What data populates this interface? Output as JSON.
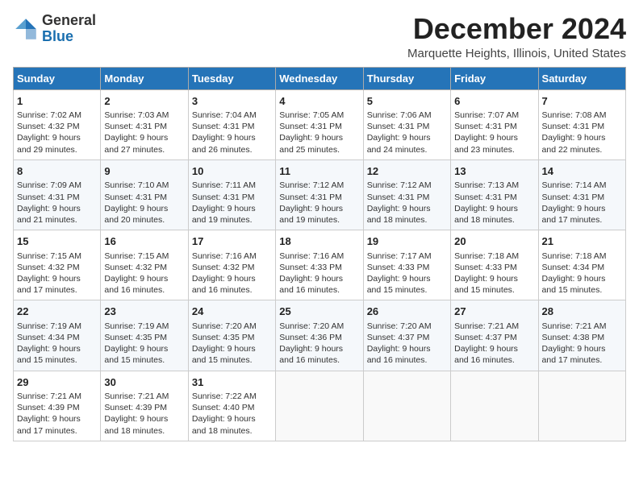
{
  "logo": {
    "general": "General",
    "blue": "Blue"
  },
  "title": "December 2024",
  "location": "Marquette Heights, Illinois, United States",
  "days_of_week": [
    "Sunday",
    "Monday",
    "Tuesday",
    "Wednesday",
    "Thursday",
    "Friday",
    "Saturday"
  ],
  "weeks": [
    [
      {
        "day": "1",
        "sunrise": "7:02 AM",
        "sunset": "4:32 PM",
        "daylight": "9 hours and 29 minutes."
      },
      {
        "day": "2",
        "sunrise": "7:03 AM",
        "sunset": "4:31 PM",
        "daylight": "9 hours and 27 minutes."
      },
      {
        "day": "3",
        "sunrise": "7:04 AM",
        "sunset": "4:31 PM",
        "daylight": "9 hours and 26 minutes."
      },
      {
        "day": "4",
        "sunrise": "7:05 AM",
        "sunset": "4:31 PM",
        "daylight": "9 hours and 25 minutes."
      },
      {
        "day": "5",
        "sunrise": "7:06 AM",
        "sunset": "4:31 PM",
        "daylight": "9 hours and 24 minutes."
      },
      {
        "day": "6",
        "sunrise": "7:07 AM",
        "sunset": "4:31 PM",
        "daylight": "9 hours and 23 minutes."
      },
      {
        "day": "7",
        "sunrise": "7:08 AM",
        "sunset": "4:31 PM",
        "daylight": "9 hours and 22 minutes."
      }
    ],
    [
      {
        "day": "8",
        "sunrise": "7:09 AM",
        "sunset": "4:31 PM",
        "daylight": "9 hours and 21 minutes."
      },
      {
        "day": "9",
        "sunrise": "7:10 AM",
        "sunset": "4:31 PM",
        "daylight": "9 hours and 20 minutes."
      },
      {
        "day": "10",
        "sunrise": "7:11 AM",
        "sunset": "4:31 PM",
        "daylight": "9 hours and 19 minutes."
      },
      {
        "day": "11",
        "sunrise": "7:12 AM",
        "sunset": "4:31 PM",
        "daylight": "9 hours and 19 minutes."
      },
      {
        "day": "12",
        "sunrise": "7:12 AM",
        "sunset": "4:31 PM",
        "daylight": "9 hours and 18 minutes."
      },
      {
        "day": "13",
        "sunrise": "7:13 AM",
        "sunset": "4:31 PM",
        "daylight": "9 hours and 18 minutes."
      },
      {
        "day": "14",
        "sunrise": "7:14 AM",
        "sunset": "4:31 PM",
        "daylight": "9 hours and 17 minutes."
      }
    ],
    [
      {
        "day": "15",
        "sunrise": "7:15 AM",
        "sunset": "4:32 PM",
        "daylight": "9 hours and 17 minutes."
      },
      {
        "day": "16",
        "sunrise": "7:15 AM",
        "sunset": "4:32 PM",
        "daylight": "9 hours and 16 minutes."
      },
      {
        "day": "17",
        "sunrise": "7:16 AM",
        "sunset": "4:32 PM",
        "daylight": "9 hours and 16 minutes."
      },
      {
        "day": "18",
        "sunrise": "7:16 AM",
        "sunset": "4:33 PM",
        "daylight": "9 hours and 16 minutes."
      },
      {
        "day": "19",
        "sunrise": "7:17 AM",
        "sunset": "4:33 PM",
        "daylight": "9 hours and 15 minutes."
      },
      {
        "day": "20",
        "sunrise": "7:18 AM",
        "sunset": "4:33 PM",
        "daylight": "9 hours and 15 minutes."
      },
      {
        "day": "21",
        "sunrise": "7:18 AM",
        "sunset": "4:34 PM",
        "daylight": "9 hours and 15 minutes."
      }
    ],
    [
      {
        "day": "22",
        "sunrise": "7:19 AM",
        "sunset": "4:34 PM",
        "daylight": "9 hours and 15 minutes."
      },
      {
        "day": "23",
        "sunrise": "7:19 AM",
        "sunset": "4:35 PM",
        "daylight": "9 hours and 15 minutes."
      },
      {
        "day": "24",
        "sunrise": "7:20 AM",
        "sunset": "4:35 PM",
        "daylight": "9 hours and 15 minutes."
      },
      {
        "day": "25",
        "sunrise": "7:20 AM",
        "sunset": "4:36 PM",
        "daylight": "9 hours and 16 minutes."
      },
      {
        "day": "26",
        "sunrise": "7:20 AM",
        "sunset": "4:37 PM",
        "daylight": "9 hours and 16 minutes."
      },
      {
        "day": "27",
        "sunrise": "7:21 AM",
        "sunset": "4:37 PM",
        "daylight": "9 hours and 16 minutes."
      },
      {
        "day": "28",
        "sunrise": "7:21 AM",
        "sunset": "4:38 PM",
        "daylight": "9 hours and 17 minutes."
      }
    ],
    [
      {
        "day": "29",
        "sunrise": "7:21 AM",
        "sunset": "4:39 PM",
        "daylight": "9 hours and 17 minutes."
      },
      {
        "day": "30",
        "sunrise": "7:21 AM",
        "sunset": "4:39 PM",
        "daylight": "9 hours and 18 minutes."
      },
      {
        "day": "31",
        "sunrise": "7:22 AM",
        "sunset": "4:40 PM",
        "daylight": "9 hours and 18 minutes."
      },
      null,
      null,
      null,
      null
    ]
  ],
  "labels": {
    "sunrise": "Sunrise: ",
    "sunset": "Sunset: ",
    "daylight": "Daylight: "
  }
}
